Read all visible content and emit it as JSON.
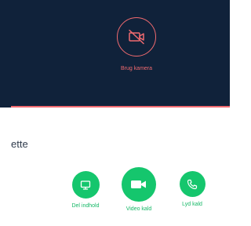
{
  "video": {
    "camera_button_label": "Brug kamera",
    "camera_icon": "video-off-icon"
  },
  "contact": {
    "name_fragment": "ette"
  },
  "actions": [
    {
      "label": "Del indhold",
      "icon": "monitor-icon"
    },
    {
      "label": "Video kald",
      "icon": "video-camera-icon"
    },
    {
      "label": "Lyd kald",
      "icon": "phone-icon"
    }
  ],
  "colors": {
    "video_bg": "#10223a",
    "accent_red": "#f06a6f",
    "accent_green": "#15c66d",
    "text_dark": "#2f3b4c"
  }
}
